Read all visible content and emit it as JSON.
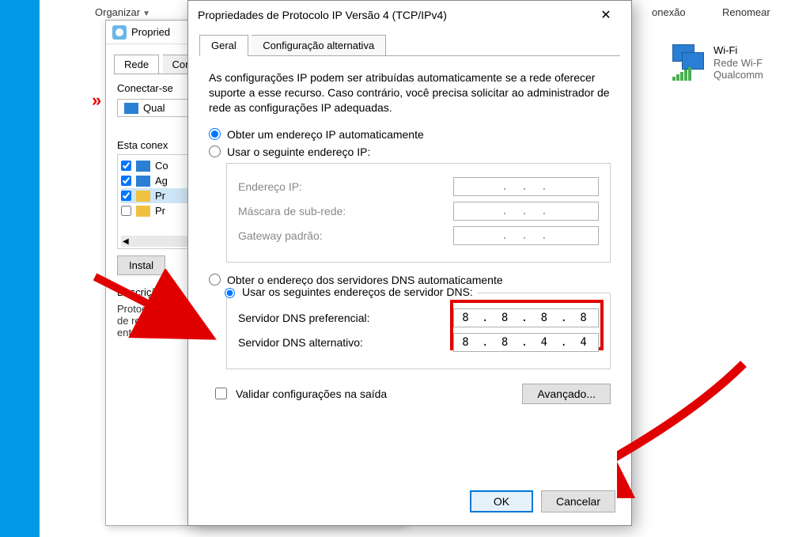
{
  "toolbar": {
    "organizar": "Organizar",
    "conexao": "onexão",
    "renomear": "Renomear"
  },
  "wifi": {
    "title": "Wi-Fi",
    "line2": "Rede Wi-F",
    "line3": "Qualcomm"
  },
  "bgWindow": {
    "title": "Propried",
    "tab1": "Rede",
    "tab2": "Con",
    "conectar": "Conectar-se",
    "qual": "Qual",
    "estaConex": "Esta conex",
    "items": [
      {
        "checked": true,
        "label": "Co"
      },
      {
        "checked": true,
        "label": "Ag"
      },
      {
        "checked": true,
        "label": "Pr",
        "highlight": true
      },
      {
        "checked": false,
        "label": "Pr"
      }
    ],
    "instalar": "Instal",
    "descricao": "Descrição",
    "descText1": "Protocolo",
    "descText2": "de rede",
    "descText3": "entre div"
  },
  "ipv4": {
    "title": "Propriedades de Protocolo IP Versão 4 (TCP/IPv4)",
    "tab_geral": "Geral",
    "tab_alt": "Configuração alternativa",
    "info": "As configurações IP podem ser atribuídas automaticamente se a rede oferecer suporte a esse recurso. Caso contrário, você precisa solicitar ao administrador de rede as configurações IP adequadas.",
    "radio_ip_auto": "Obter um endereço IP automaticamente",
    "radio_ip_manual": "Usar o seguinte endereço IP:",
    "label_ip": "Endereço IP:",
    "label_mask": "Máscara de sub-rede:",
    "label_gateway": "Gateway padrão:",
    "radio_dns_auto": "Obter o endereço dos servidores DNS automaticamente",
    "radio_dns_manual": "Usar os seguintes endereços de servidor DNS:",
    "label_dns_pref": "Servidor DNS preferencial:",
    "label_dns_alt": "Servidor DNS alternativo:",
    "dns_pref_value": "8 . 8 . 8 . 8",
    "dns_alt_value": "8 . 8 . 4 . 4",
    "validate": "Validar configurações na saída",
    "advanced": "Avançado...",
    "ok": "OK",
    "cancel": "Cancelar",
    "ip_placeholder": ".       .       ."
  }
}
